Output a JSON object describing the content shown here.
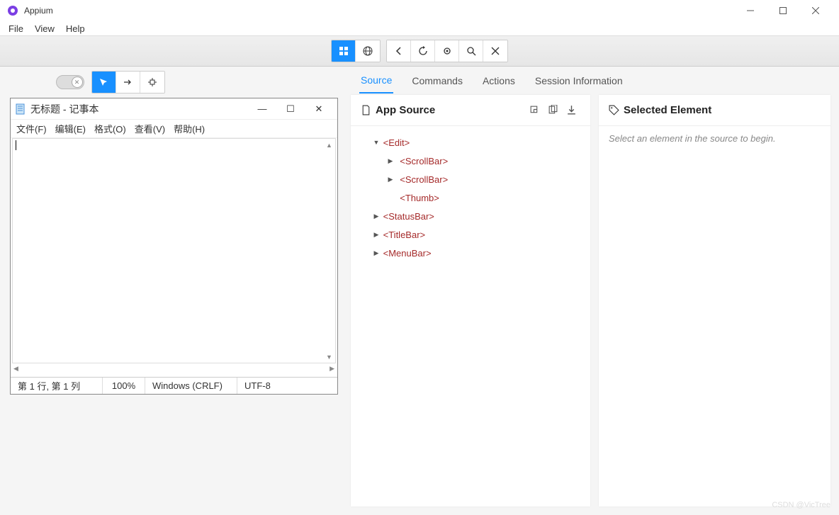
{
  "window": {
    "title": "Appium"
  },
  "menu": {
    "file": "File",
    "view": "View",
    "help": "Help"
  },
  "notepad": {
    "title": "无标题 - 记事本",
    "menu": {
      "file": "文件(F)",
      "edit": "编辑(E)",
      "format": "格式(O)",
      "view": "查看(V)",
      "help": "帮助(H)"
    },
    "status": {
      "pos": "第 1 行, 第 1 列",
      "zoom": "100%",
      "eol": "Windows (CRLF)",
      "encoding": "UTF-8"
    }
  },
  "tabs": {
    "source": "Source",
    "commands": "Commands",
    "actions": "Actions",
    "session": "Session Information"
  },
  "source_panel": {
    "title": "App Source",
    "tree": [
      {
        "label": "<Edit>",
        "indent": 1,
        "expanded": true
      },
      {
        "label": "<ScrollBar>",
        "indent": 2,
        "caret": true
      },
      {
        "label": "<ScrollBar>",
        "indent": 2,
        "caret": true
      },
      {
        "label": "<Thumb>",
        "indent": 2,
        "caret": false
      },
      {
        "label": "<StatusBar>",
        "indent": 1,
        "caret": true
      },
      {
        "label": "<TitleBar>",
        "indent": 1,
        "caret": true
      },
      {
        "label": "<MenuBar>",
        "indent": 1,
        "caret": true
      }
    ]
  },
  "selected_panel": {
    "title": "Selected Element",
    "empty_text": "Select an element in the source to begin."
  },
  "watermark": "CSDN @VicTree"
}
